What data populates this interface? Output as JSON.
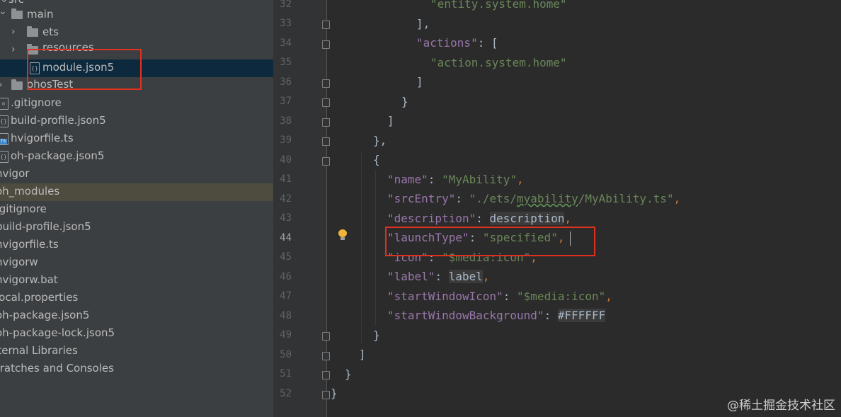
{
  "project_tree": {
    "items": [
      {
        "label": "src"
      },
      {
        "label": "main"
      },
      {
        "label": "ets"
      },
      {
        "label": "resources"
      },
      {
        "label": "module.json5"
      },
      {
        "label": "ohosTest"
      },
      {
        "label": ".gitignore"
      },
      {
        "label": "build-profile.json5"
      },
      {
        "label": "hvigorfile.ts"
      },
      {
        "label": "oh-package.json5"
      },
      {
        "label": "hvigor"
      },
      {
        "label": "oh_modules"
      },
      {
        "label": ".gitignore"
      },
      {
        "label": "build-profile.json5"
      },
      {
        "label": "hvigorfile.ts"
      },
      {
        "label": "hvigorw"
      },
      {
        "label": "hvigorw.bat"
      },
      {
        "label": "local.properties"
      },
      {
        "label": "oh-package.json5"
      },
      {
        "label": "oh-package-lock.json5"
      },
      {
        "label": "External Libraries"
      },
      {
        "label": "Scratches and Consoles"
      }
    ],
    "icon_names": [
      "folder-icon",
      "json5-file-icon",
      "gitignore-file-icon",
      "ts-file-icon"
    ]
  },
  "editor": {
    "line_numbers": [
      "32",
      "33",
      "34",
      "35",
      "36",
      "37",
      "38",
      "39",
      "40",
      "41",
      "42",
      "43",
      "44",
      "45",
      "46",
      "47",
      "48",
      "49",
      "50",
      "51",
      "52"
    ],
    "current_line": "44",
    "code": {
      "l32_str": "\"entity.system.home\"",
      "l33": "],",
      "l34_key": "\"actions\"",
      "l34_rest": ": [",
      "l35_str": "\"action.system.home\"",
      "l36": "]",
      "l37": "}",
      "l38": "]",
      "l39": "},",
      "l40": "{",
      "l41_key": "\"name\"",
      "l41_val": "\"MyAbility\"",
      "l42_key": "\"srcEntry\"",
      "l42_val_a": "\"./ets/",
      "l42_val_b": "myability",
      "l42_val_c": "/MyAbility.ts\"",
      "l43_key": "\"description\"",
      "l43_val": "description",
      "l44_key": "\"launchType\"",
      "l44_val": "\"specified\"",
      "l45_key": "\"icon\"",
      "l45_val": "\"$media:icon\"",
      "l46_key": "\"label\"",
      "l46_val": "label",
      "l47_key": "\"startWindowIcon\"",
      "l47_val": "\"$media:icon\"",
      "l48_key": "\"startWindowBackground\"",
      "l48_val": "#FFFFFF",
      "l49": "}",
      "l50": "]",
      "l51": "}",
      "l52": "}"
    }
  },
  "watermark": "@稀土掘金技术社区",
  "colors": {
    "accent_highlight": "#e0311f",
    "key_purple": "#9876aa",
    "string_green": "#6a8759",
    "punct_orange": "#cc7832",
    "selection_blue": "#0d293e"
  }
}
